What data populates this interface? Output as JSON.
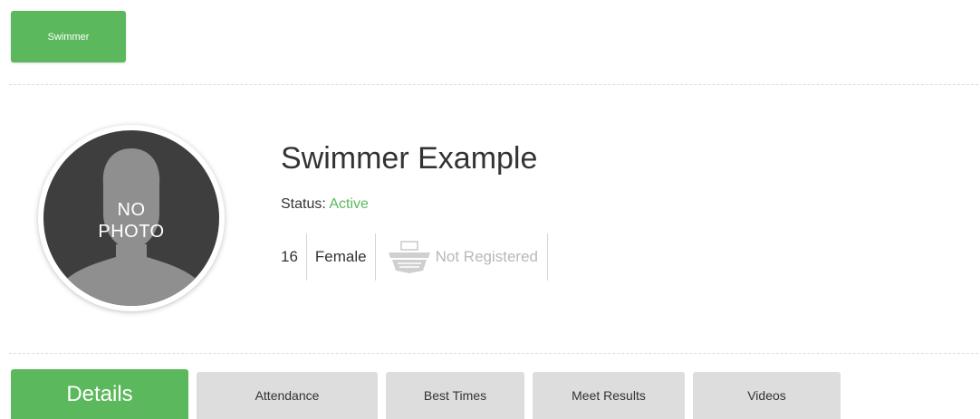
{
  "role_badge": {
    "label": "Swimmer",
    "color": "#5cb85c"
  },
  "profile": {
    "photo_placeholder_line1": "NO",
    "photo_placeholder_line2": "PHOTO",
    "name": "Swimmer Example",
    "status_label": "Status:",
    "status_value": "Active",
    "status_color": "#5cb85c",
    "age": "16",
    "gender": "Female",
    "registration_icon": "usa-swimming-logo-icon",
    "registration_status": "Not Registered"
  },
  "tabs": [
    {
      "label": "Details",
      "active": true
    },
    {
      "label": "Attendance",
      "active": false
    },
    {
      "label": "Best Times",
      "active": false
    },
    {
      "label": "Meet Results",
      "active": false
    },
    {
      "label": "Videos",
      "active": false
    }
  ]
}
